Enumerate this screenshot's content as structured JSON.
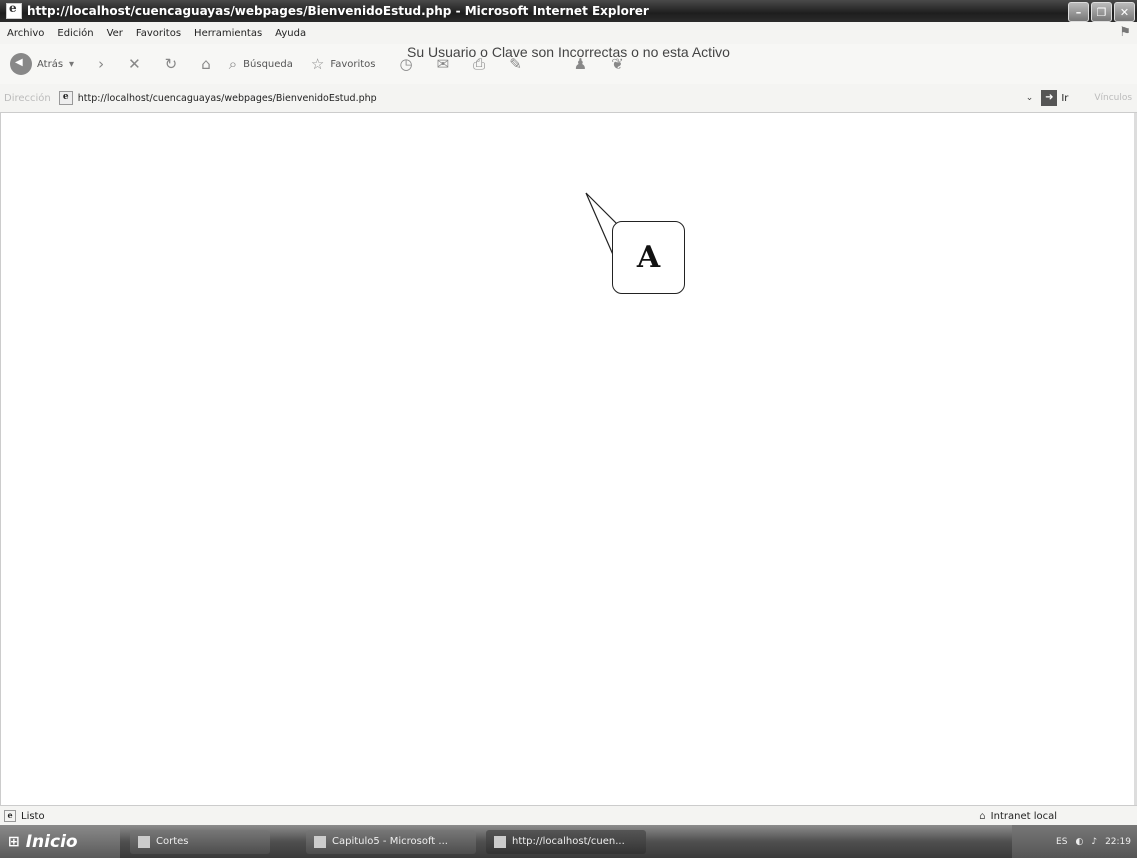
{
  "window": {
    "title": "http://localhost/cuencaguayas/webpages/BienvenidoEstud.php - Microsoft Internet Explorer",
    "minimize_icon": "minimize-icon",
    "restore_icon": "restore-icon",
    "close_icon": "close-icon"
  },
  "menu": {
    "items": [
      "Archivo",
      "Edición",
      "Ver",
      "Favoritos",
      "Herramientas",
      "Ayuda"
    ]
  },
  "toolbar": {
    "back_label": "Atrás",
    "search_label": "Búsqueda",
    "favorites_label": "Favoritos"
  },
  "address": {
    "label": "Dirección",
    "url": "http://localhost/cuencaguayas/webpages/BienvenidoEstud.php",
    "go_label": "Ir",
    "links_label": "Vínculos"
  },
  "content": {
    "message": "Su Usuario o Clave son Incorrectas o no esta Activo",
    "callout_label": "A"
  },
  "status": {
    "left": "Listo",
    "right": "Intranet local"
  },
  "taskbar": {
    "start": "Inicio",
    "tasks": [
      "Cortes",
      "Capitulo5 - Microsoft ...",
      "http://localhost/cuen..."
    ],
    "tray_lang": "ES",
    "clock": "22:19"
  }
}
